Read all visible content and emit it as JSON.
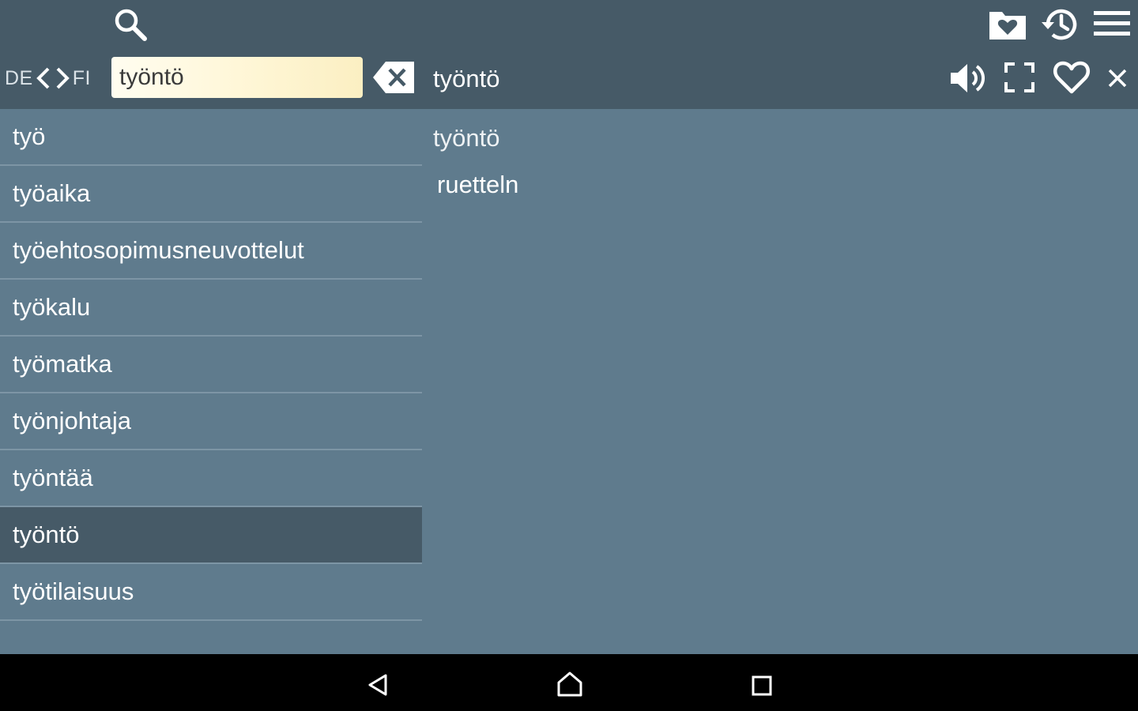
{
  "toolbar": {
    "search_icon": "search-icon",
    "favorites_icon": "favorites-folder-icon",
    "history_icon": "history-icon",
    "menu_icon": "menu-icon"
  },
  "language": {
    "source": "DE",
    "target": "FI"
  },
  "search": {
    "value": "työntö"
  },
  "entry_header": {
    "word": "työntö",
    "actions": [
      "speaker-icon",
      "fullscreen-icon",
      "heart-icon",
      "close-icon"
    ]
  },
  "word_list": {
    "items": [
      "työ",
      "työaika",
      "työehtosopimusneuvottelut",
      "työkalu",
      "työmatka",
      "työnjohtaja",
      "työntää",
      "työntö",
      "työtilaisuus"
    ],
    "selected_index": 7
  },
  "entry": {
    "headword": "työntö",
    "translation": "ruetteln"
  },
  "colors": {
    "toolbar": "#465a67",
    "content": "#5f7b8d",
    "divider": "#7d95a5",
    "selected": "#465a67",
    "navbar": "#000000"
  },
  "navbar": {
    "icons": [
      "back-icon",
      "home-icon",
      "recents-icon"
    ]
  }
}
